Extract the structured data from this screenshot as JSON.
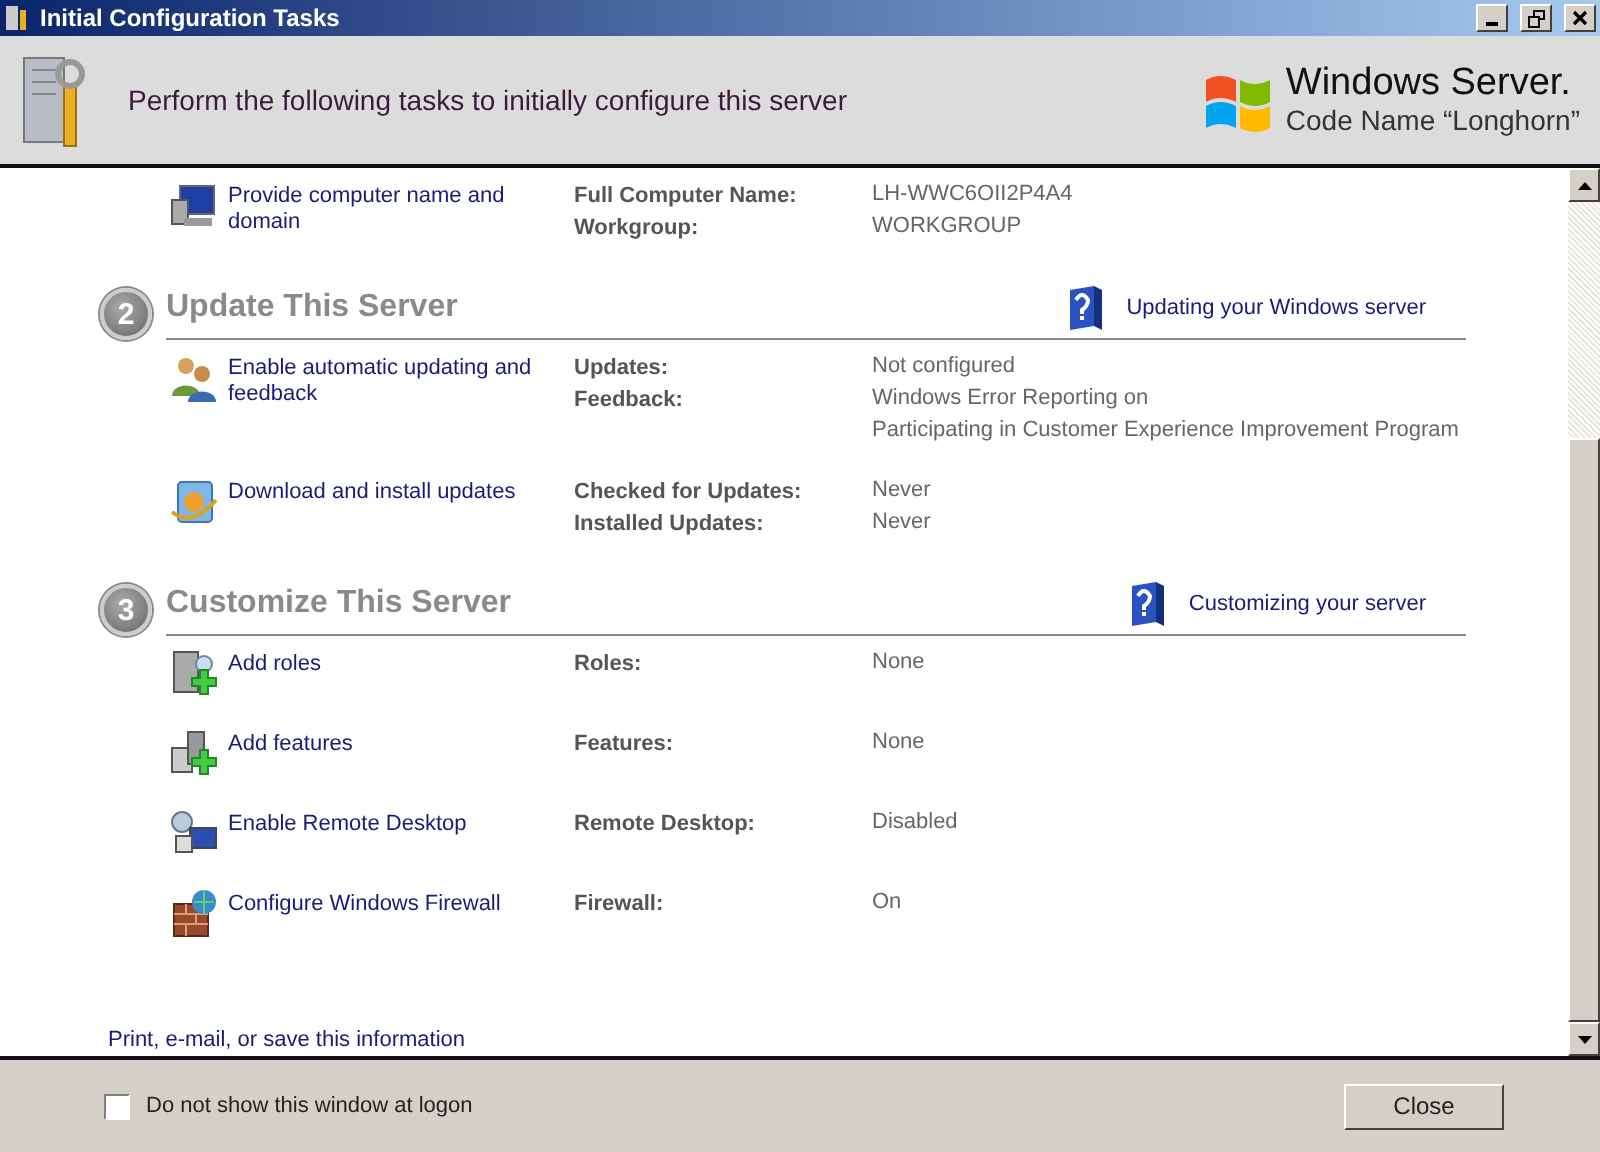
{
  "window": {
    "title": "Initial Configuration Tasks"
  },
  "header": {
    "text": "Perform the following tasks to initially configure this server",
    "logo_title": "Windows Server.",
    "logo_subtitle": "Code Name “Longhorn”"
  },
  "sections": [
    {
      "tasks": [
        {
          "kind": "computer",
          "link": "Provide computer name and domain",
          "details": [
            {
              "label": "Full Computer Name:",
              "values": [
                "LH-WWC6OII2P4A4"
              ]
            },
            {
              "label": "Workgroup:",
              "values": [
                "WORKGROUP"
              ]
            }
          ]
        }
      ]
    },
    {
      "number": "2",
      "title": "Update This Server",
      "help_link": "Updating your Windows server",
      "tasks": [
        {
          "kind": "people",
          "link": "Enable automatic updating and feedback",
          "details": [
            {
              "label": "Updates:",
              "values": [
                "Not configured"
              ]
            },
            {
              "label": "Feedback:",
              "values": [
                "Windows Error Reporting on",
                "Participating in Customer Experience Improvement Program"
              ]
            }
          ]
        },
        {
          "kind": "update",
          "link": "Download and install updates",
          "details": [
            {
              "label": "Checked for Updates:",
              "values": [
                "Never"
              ]
            },
            {
              "label": "Installed Updates:",
              "values": [
                "Never"
              ]
            }
          ]
        }
      ]
    },
    {
      "number": "3",
      "title": "Customize This Server",
      "help_link": "Customizing your server",
      "tasks": [
        {
          "kind": "roles",
          "link": "Add roles",
          "details": [
            {
              "label": "Roles:",
              "values": [
                "None"
              ]
            }
          ]
        },
        {
          "kind": "features",
          "link": "Add features",
          "details": [
            {
              "label": "Features:",
              "values": [
                "None"
              ]
            }
          ]
        },
        {
          "kind": "remote",
          "link": "Enable Remote Desktop",
          "details": [
            {
              "label": "Remote Desktop:",
              "values": [
                "Disabled"
              ]
            }
          ]
        },
        {
          "kind": "firewall",
          "link": "Configure Windows Firewall",
          "details": [
            {
              "label": "Firewall:",
              "values": [
                "On"
              ]
            }
          ]
        }
      ]
    }
  ],
  "footer_link": "Print, e-mail, or save this information",
  "bottom": {
    "checkbox": {
      "label": "Do not show this window at logon",
      "checked": false
    },
    "close_button": "Close"
  }
}
